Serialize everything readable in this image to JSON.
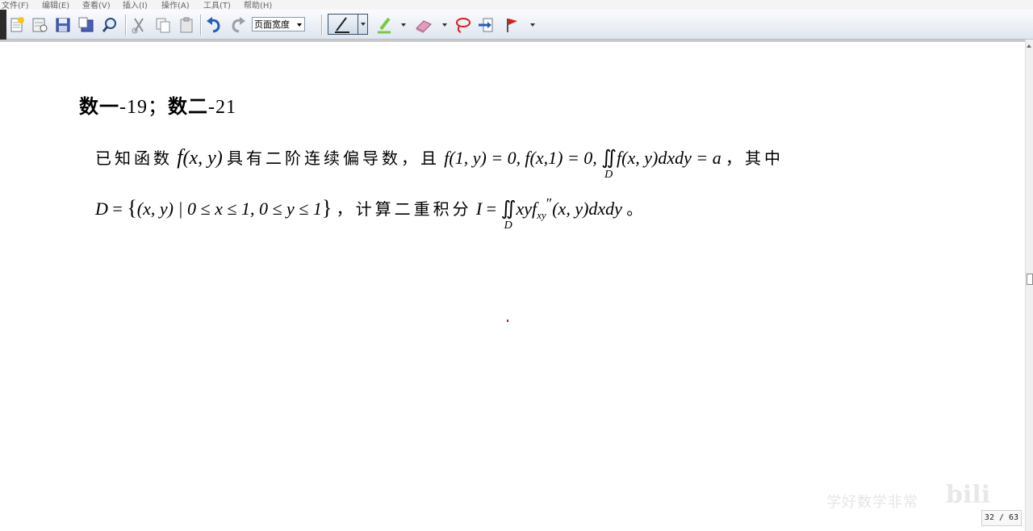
{
  "menu": [
    {
      "label": "文件(F)"
    },
    {
      "label": "编辑(E)"
    },
    {
      "label": "查看(V)"
    },
    {
      "label": "插入(I)"
    },
    {
      "label": "操作(A)"
    },
    {
      "label": "工具(T)"
    },
    {
      "label": "帮助(H)"
    }
  ],
  "toolbar": {
    "zoom_value": "页面宽度",
    "icons": [
      "new-page-icon",
      "open-icon",
      "save-icon",
      "save-as-icon",
      "find-icon",
      "cut-icon",
      "copy-icon",
      "paste-icon",
      "undo-icon",
      "redo-icon",
      "pen-icon",
      "highlighter-icon",
      "eraser-icon",
      "lasso-icon",
      "insert-space-icon",
      "flag-icon"
    ],
    "colors": {
      "highlighter": "#7ac943",
      "undo": "#1f5fbf",
      "flag": "#d42020",
      "lasso": "#d42020"
    }
  },
  "problem": {
    "heading_a": "数一",
    "heading_a_num": "-19；",
    "heading_b": "数二",
    "heading_b_num": "-21",
    "l1_t1": "已知函数",
    "l1_f": "f",
    "l1_m1": "(x, y)",
    "l1_t2": "具有二阶连续偏导数，且",
    "l1_c1": "(1, y) = 0,",
    "l1_c2": "(x,1) = 0,",
    "iint": "∬",
    "region": "D",
    "l1_c3a": "(x, y)",
    "l1_c3b": "dxdy",
    "l1_c3c": " = a",
    "l1_t3": "，其中",
    "l2_a": "D",
    "l2_b": " = ",
    "l2_c": "(x, y) | 0 ≤ x ≤ 1, 0 ≤ y ≤ 1",
    "lbrace": "{",
    "rbrace": "}",
    "l2_t1": "，计算二重积分",
    "l2_I": "I",
    "l2_eq": " = ",
    "l2_xyf": "xyf",
    "l2_sub": "xy",
    "l2_prime": "″",
    "l2_rest": "(x, y)",
    "l2_dxdy": "dxdy",
    "l2_end": "。"
  },
  "status": {
    "page_counter": "32 / 63",
    "watermark": "学好数学非常",
    "watermark_logo": "bili"
  }
}
